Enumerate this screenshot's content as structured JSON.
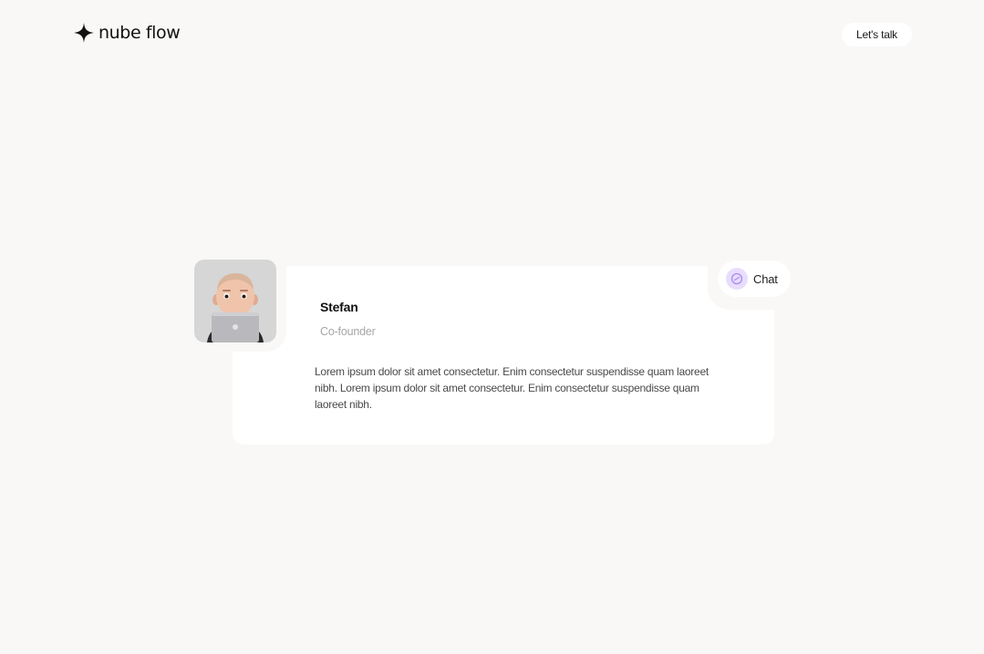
{
  "header": {
    "logo_text": "nube flow",
    "logo_icon": "four-point-star-icon",
    "cta_label": "Let's talk"
  },
  "profile": {
    "name": "Stefan",
    "role": "Co-founder",
    "bio": "Lorem ipsum dolor sit amet consectetur. Enim consectetur suspendisse quam laoreet nibh. Lorem ipsum dolor sit amet consectetur. Enim consectetur suspendisse quam laoreet nibh.",
    "avatar": "memoji-with-laptop",
    "chat_label": "Chat",
    "chat_icon": "chat-icon"
  },
  "colors": {
    "background": "#f9f8f7",
    "card": "#ffffff",
    "chat_icon_bg": "#e8ddfc",
    "chat_icon_fg": "#a98bf0"
  }
}
